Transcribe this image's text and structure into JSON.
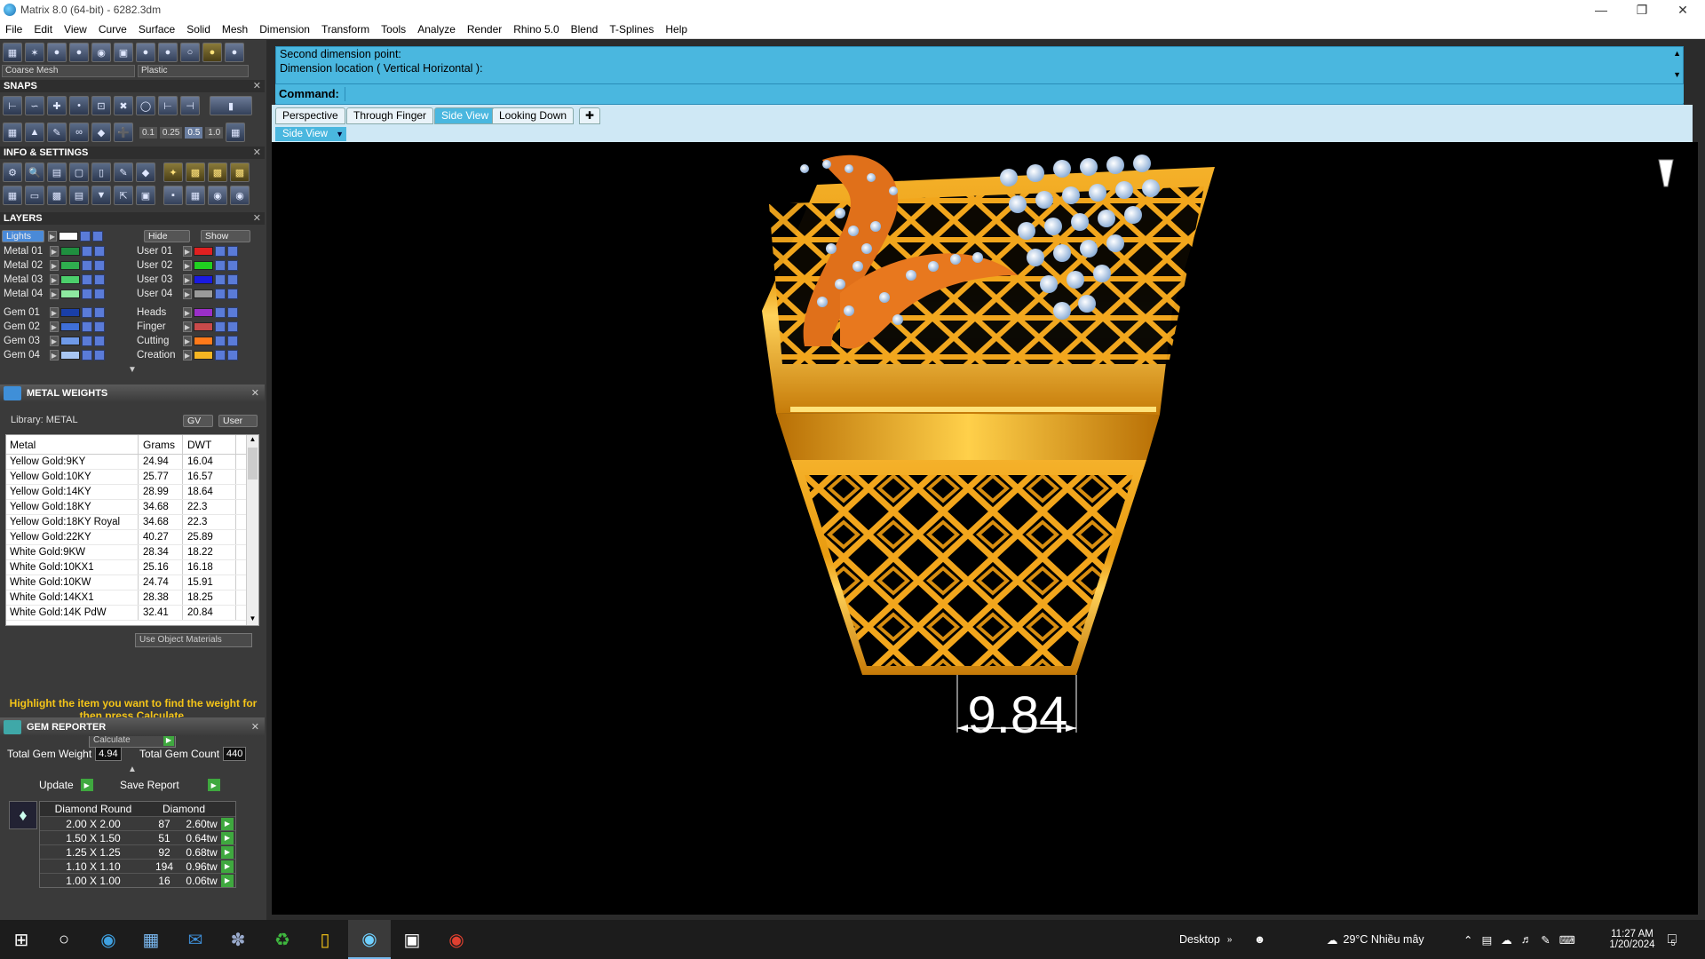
{
  "window": {
    "title": "Matrix 8.0 (64-bit) - 6282.3dm"
  },
  "menu": [
    "File",
    "Edit",
    "View",
    "Curve",
    "Surface",
    "Solid",
    "Mesh",
    "Dimension",
    "Transform",
    "Tools",
    "Analyze",
    "Render",
    "Rhino 5.0",
    "Blend",
    "T-Splines",
    "Help"
  ],
  "left": {
    "mesh_dropdown": "Coarse Mesh",
    "material_dropdown": "Plastic",
    "snaps_title": "SNAPS",
    "snap_values": [
      "0.1",
      "0.25",
      "0.5",
      "1.0"
    ],
    "info_title": "INFO & SETTINGS",
    "layers_title": "LAYERS",
    "lights_label": "Lights",
    "hide_label": "Hide",
    "show_label": "Show",
    "layers_left": [
      {
        "name": "Metal 01",
        "color": "#1f8f3f"
      },
      {
        "name": "Metal 02",
        "color": "#2fae4f"
      },
      {
        "name": "Metal 03",
        "color": "#4ccf6c"
      },
      {
        "name": "Metal 04",
        "color": "#8ee8a0"
      },
      {
        "name": "Gem 01",
        "color": "#1a3fa8"
      },
      {
        "name": "Gem 02",
        "color": "#3f6fd8"
      },
      {
        "name": "Gem 03",
        "color": "#6f9ae8"
      },
      {
        "name": "Gem 04",
        "color": "#a8c6f2"
      }
    ],
    "layers_right": [
      {
        "name": "User 01",
        "color": "#e02020"
      },
      {
        "name": "User 02",
        "color": "#20d020"
      },
      {
        "name": "User 03",
        "color": "#1a1ae0"
      },
      {
        "name": "User 04",
        "color": "#9a9a9a"
      },
      {
        "name": "Heads",
        "color": "#9a2fc8"
      },
      {
        "name": "Finger",
        "color": "#c84a4a"
      },
      {
        "name": "Cutting",
        "color": "#ff7a1a"
      },
      {
        "name": "Creation",
        "color": "#f5b522"
      }
    ],
    "metal_weights": {
      "title": "METAL WEIGHTS",
      "library_label": "Library: METAL",
      "gv_label": "GV",
      "user_label": "User",
      "columns": [
        "Metal",
        "Grams",
        "DWT"
      ],
      "rows": [
        [
          "Yellow Gold:9KY",
          "24.94",
          "16.04"
        ],
        [
          "Yellow Gold:10KY",
          "25.77",
          "16.57"
        ],
        [
          "Yellow Gold:14KY",
          "28.99",
          "18.64"
        ],
        [
          "Yellow Gold:18KY",
          "34.68",
          "22.3"
        ],
        [
          "Yellow Gold:18KY Royal",
          "34.68",
          "22.3"
        ],
        [
          "Yellow Gold:22KY",
          "40.27",
          "25.89"
        ],
        [
          "White Gold:9KW",
          "28.34",
          "18.22"
        ],
        [
          "White Gold:10KX1",
          "25.16",
          "16.18"
        ],
        [
          "White Gold:10KW",
          "24.74",
          "15.91"
        ],
        [
          "White Gold:14KX1",
          "28.38",
          "18.25"
        ],
        [
          "White Gold:14K PdW",
          "32.41",
          "20.84"
        ]
      ],
      "use_object_materials": "Use Object Materials",
      "hint": "Highlight the item you want to find the weight for then press Calculate.",
      "calculate_label": "Calculate"
    },
    "gem_reporter": {
      "title": "GEM REPORTER",
      "total_weight_label": "Total Gem Weight",
      "total_weight": "4.94",
      "total_count_label": "Total Gem Count",
      "total_count": "440",
      "update_label": "Update",
      "save_label": "Save Report",
      "columns": [
        "Diamond Round",
        "Diamond"
      ],
      "rows": [
        [
          "2.00 X 2.00",
          "87",
          "2.60tw"
        ],
        [
          "1.50 X 1.50",
          "51",
          "0.64tw"
        ],
        [
          "1.25 X 1.25",
          "92",
          "0.68tw"
        ],
        [
          "1.10 X 1.10",
          "194",
          "0.96tw"
        ],
        [
          "1.00 X 1.00",
          "16",
          "0.06tw"
        ]
      ]
    }
  },
  "command": {
    "line1": "Second dimension point:",
    "line2": "Dimension location ( Vertical  Horizontal ):",
    "prompt": "Command:"
  },
  "tabs": [
    "Perspective",
    "Through Finger",
    "Side View",
    "Looking Down"
  ],
  "active_tab": "Side View",
  "view_label": "Side View",
  "viewport": {
    "dimension_value": "9.84"
  },
  "taskbar": {
    "desktop_label": "Desktop",
    "weather": "29°C  Nhiều mây",
    "time": "11:27 AM",
    "date": "1/20/2024",
    "notif_count": "5"
  }
}
